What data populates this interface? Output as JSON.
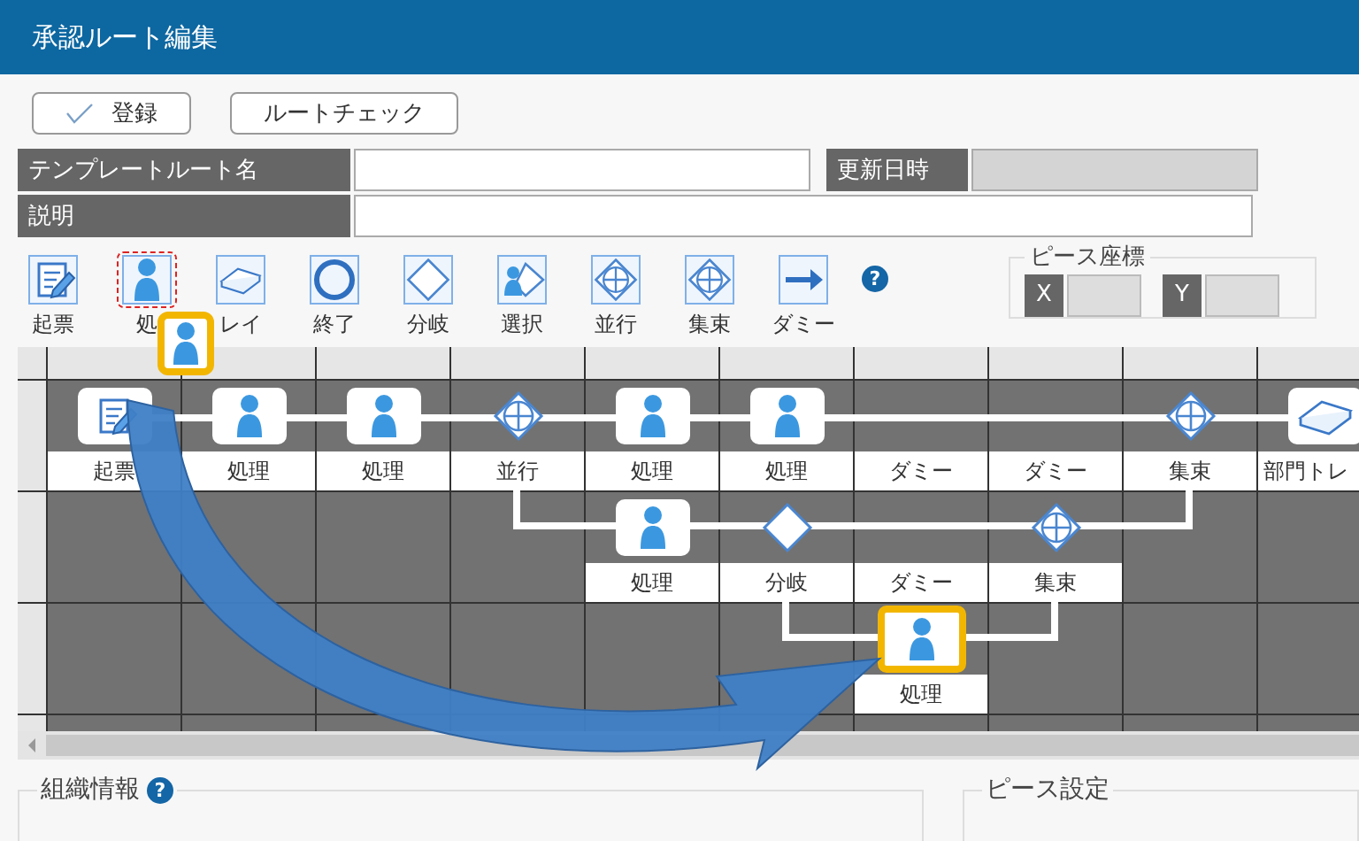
{
  "window": {
    "title": "承認ルート編集"
  },
  "actions": [
    {
      "label": "登録",
      "kind": "check"
    },
    {
      "label": "ルートチェック",
      "kind": "plain"
    }
  ],
  "form": {
    "fields": [
      {
        "label": "テンプレートルート名",
        "readonly": false
      },
      {
        "label": "更新日時",
        "readonly": true
      }
    ],
    "description": {
      "label": "説明"
    }
  },
  "toolbar": {
    "tools": [
      {
        "kind": "form",
        "label": "起票",
        "selected": false
      },
      {
        "kind": "person",
        "label": "処",
        "selected": true
      },
      {
        "kind": "tray",
        "label": "レイ",
        "selected": false
      },
      {
        "kind": "end",
        "label": "終了",
        "selected": false
      },
      {
        "kind": "branch",
        "label": "分岐",
        "selected": false
      },
      {
        "kind": "select",
        "label": "選択",
        "selected": false
      },
      {
        "kind": "parallel",
        "label": "並行",
        "selected": false
      },
      {
        "kind": "merge",
        "label": "集束",
        "selected": false
      },
      {
        "kind": "dummy",
        "label": "ダミー",
        "selected": false
      }
    ],
    "help": "?"
  },
  "coordinates": {
    "title": "ピース座標",
    "x_label": "X",
    "y_label": "Y"
  },
  "grid": {
    "rows": [
      {
        "cells": [
          {
            "kind": "form",
            "label": "起票",
            "highlighted": false
          },
          {
            "kind": "person",
            "label": "処理",
            "highlighted": false
          },
          {
            "kind": "person",
            "label": "処理",
            "highlighted": false
          },
          {
            "kind": "parallel",
            "label": "並行"
          },
          {
            "kind": "person",
            "label": "処理",
            "highlighted": false
          },
          {
            "kind": "person",
            "label": "処理",
            "highlighted": false
          },
          {
            "kind": "dummy",
            "label": "ダミー"
          },
          {
            "kind": "dummy",
            "label": "ダミー"
          },
          {
            "kind": "merge",
            "label": "集束"
          },
          {
            "kind": "tray",
            "label": "部門トレ",
            "highlighted": false
          }
        ]
      },
      {
        "cells": [
          {
            "kind": "empty"
          },
          {
            "kind": "empty"
          },
          {
            "kind": "empty"
          },
          {
            "kind": "empty"
          },
          {
            "kind": "person",
            "label": "処理",
            "highlighted": false
          },
          {
            "kind": "branch",
            "label": "分岐"
          },
          {
            "kind": "dummy",
            "label": "ダミー"
          },
          {
            "kind": "merge",
            "label": "集束"
          },
          {
            "kind": "empty"
          },
          {
            "kind": "empty"
          }
        ]
      },
      {
        "cells": [
          {
            "kind": "empty"
          },
          {
            "kind": "empty"
          },
          {
            "kind": "empty"
          },
          {
            "kind": "empty"
          },
          {
            "kind": "empty"
          },
          {
            "kind": "empty"
          },
          {
            "kind": "person",
            "label": "処理",
            "highlighted": true
          },
          {
            "kind": "empty"
          },
          {
            "kind": "empty"
          },
          {
            "kind": "empty"
          }
        ]
      }
    ]
  },
  "org_info": {
    "title": "組織情報",
    "help": "?"
  },
  "piece_settings": {
    "title": "ピース設定"
  }
}
